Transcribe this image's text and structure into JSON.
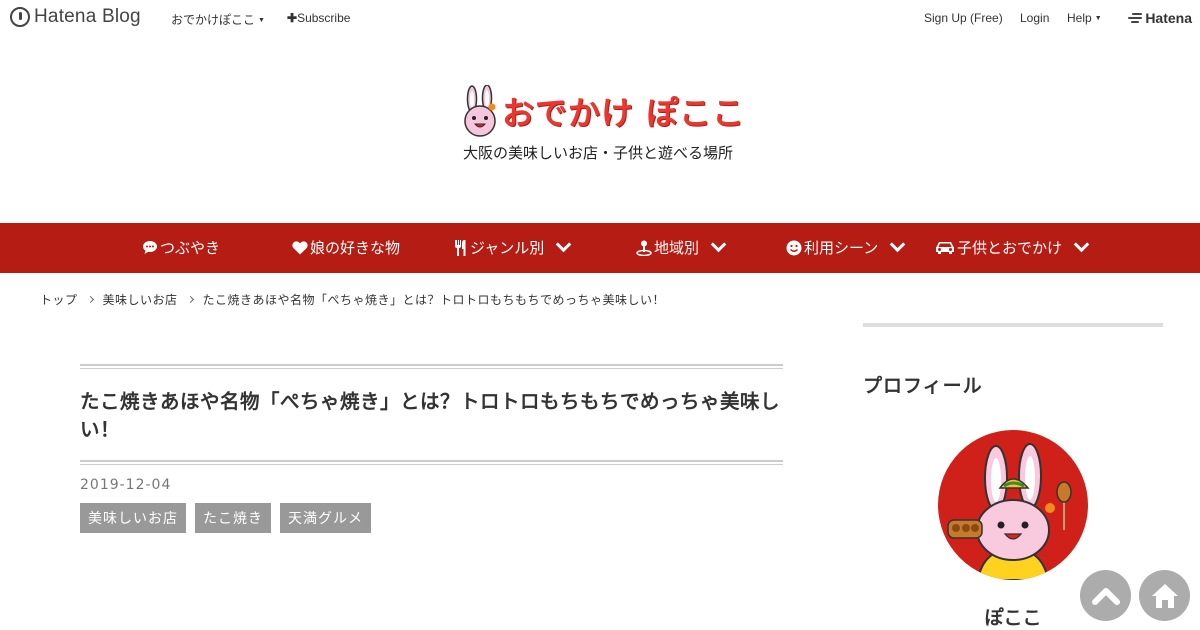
{
  "topbar": {
    "brand": "Hatena Blog",
    "blog_menu": "おでかけぽここ",
    "subscribe": "Subscribe",
    "signup": "Sign Up (Free)",
    "login": "Login",
    "help": "Help",
    "hatena": "Hatena"
  },
  "header": {
    "title": "おでかけ ぽここ",
    "description": "大阪の美味しいお店・子供と遊べる場所"
  },
  "nav": {
    "items": [
      {
        "label": "つぶやき",
        "icon": "comment-icon",
        "has_dropdown": false
      },
      {
        "label": "娘の好きな物",
        "icon": "heart-icon",
        "has_dropdown": false
      },
      {
        "label": "ジャンル別",
        "icon": "cutlery-icon",
        "has_dropdown": true
      },
      {
        "label": "地域別",
        "icon": "map-pin-icon",
        "has_dropdown": true
      },
      {
        "label": "利用シーン",
        "icon": "smile-icon",
        "has_dropdown": true
      },
      {
        "label": "子供とおでかけ",
        "icon": "car-icon",
        "has_dropdown": true
      }
    ]
  },
  "breadcrumb": [
    "トップ",
    "美味しいお店",
    "たこ焼きあほや名物「ぺちゃ焼き」とは？トロトロもちもちでめっちゃ美味しい！"
  ],
  "article": {
    "title": "たこ焼きあほや名物「ぺちゃ焼き」とは？トロトロもちもちでめっちゃ美味しい！",
    "date": "2019-12-04",
    "tags": [
      "美味しいお店",
      "たこ焼き",
      "天満グルメ"
    ]
  },
  "sidebar": {
    "heading": "プロフィール",
    "name": "ぽここ"
  },
  "colors": {
    "nav_bg": "#b41c14",
    "title_red": "#e8382f",
    "tag_bg": "#999999"
  }
}
